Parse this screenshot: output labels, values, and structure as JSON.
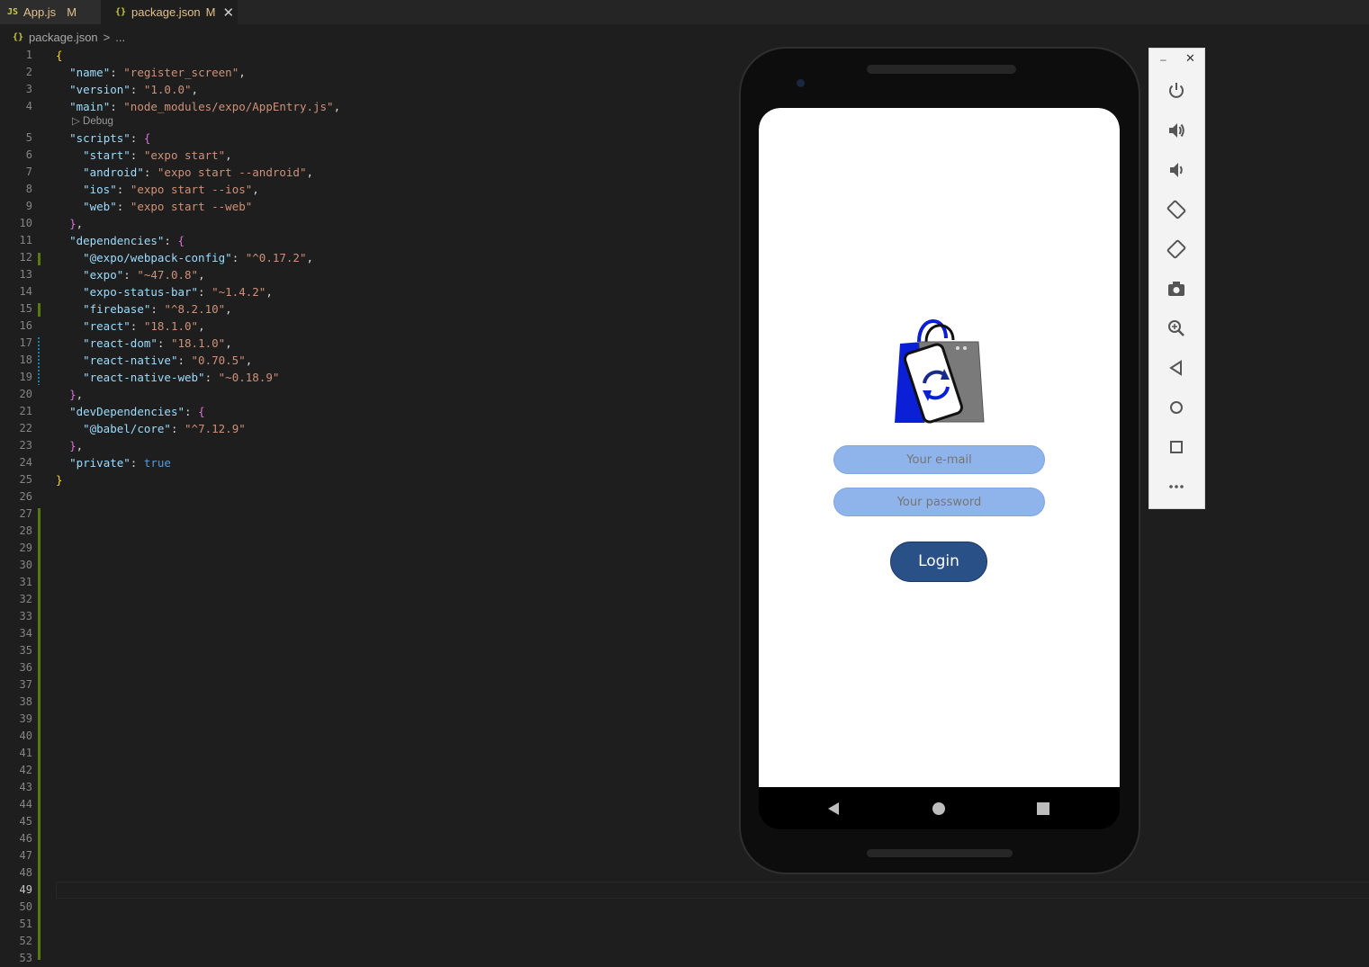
{
  "tabs": [
    {
      "icon": "JS",
      "label": "App.js",
      "status": "M"
    },
    {
      "icon": "{}",
      "label": "package.json",
      "status": "M",
      "close": "✕"
    }
  ],
  "breadcrumb": {
    "icon": "{}",
    "file": "package.json",
    "separator": ">",
    "rest": "..."
  },
  "line_numbers": [
    "1",
    "2",
    "3",
    "4",
    "5",
    "6",
    "7",
    "8",
    "9",
    "10",
    "11",
    "12",
    "13",
    "14",
    "15",
    "16",
    "17",
    "18",
    "19",
    "20",
    "21",
    "22",
    "23",
    "24",
    "25",
    "26",
    "27",
    "28",
    "29",
    "30",
    "31",
    "32",
    "33",
    "34",
    "35",
    "36",
    "37",
    "38",
    "39",
    "40",
    "41",
    "42",
    "43",
    "44",
    "45",
    "46",
    "47",
    "48",
    "49",
    "50",
    "51",
    "52",
    "53"
  ],
  "active_line": "49",
  "code_lens": "▷ Debug",
  "code": {
    "l1": "{",
    "name_k": "\"name\"",
    "name_v": "\"register_screen\"",
    "version_k": "\"version\"",
    "version_v": "\"1.0.0\"",
    "main_k": "\"main\"",
    "main_v": "\"node_modules/expo/AppEntry.js\"",
    "scripts_k": "\"scripts\"",
    "start_k": "\"start\"",
    "start_v": "\"expo start\"",
    "android_k": "\"android\"",
    "android_v": "\"expo start --android\"",
    "ios_k": "\"ios\"",
    "ios_v": "\"expo start --ios\"",
    "web_k": "\"web\"",
    "web_v": "\"expo start --web\"",
    "deps_k": "\"dependencies\"",
    "d1_k": "\"@expo/webpack-config\"",
    "d1_v": "\"^0.17.2\"",
    "d2_k": "\"expo\"",
    "d2_v": "\"~47.0.8\"",
    "d3_k": "\"expo-status-bar\"",
    "d3_v": "\"~1.4.2\"",
    "d4_k": "\"firebase\"",
    "d4_v": "\"^8.2.10\"",
    "d5_k": "\"react\"",
    "d5_v": "\"18.1.0\"",
    "d6_k": "\"react-dom\"",
    "d6_v": "\"18.1.0\"",
    "d7_k": "\"react-native\"",
    "d7_v": "\"0.70.5\"",
    "d8_k": "\"react-native-web\"",
    "d8_v": "\"~0.18.9\"",
    "devdeps_k": "\"devDependencies\"",
    "dd1_k": "\"@babel/core\"",
    "dd1_v": "\"^7.12.9\"",
    "private_k": "\"private\"",
    "private_v": "true",
    "l25": "}"
  },
  "phone": {
    "email_placeholder": "Your e-mail",
    "password_placeholder": "Your password",
    "login_label": "Login"
  },
  "emulator_toolbar": {
    "minimize": "–",
    "close": "✕",
    "buttons": [
      "power-icon",
      "volume-up-icon",
      "volume-down-icon",
      "rotate-left-icon",
      "rotate-right-icon",
      "camera-icon",
      "zoom-icon",
      "back-icon",
      "home-icon",
      "overview-icon",
      "more-icon"
    ]
  },
  "colors": {
    "editor_bg": "#1e1e1e",
    "json_key": "#9cdcfe",
    "json_string": "#ce9178",
    "login_button": "#2a5088",
    "input_fill": "#8fb4ec",
    "logo_blue": "#0a1fd6"
  }
}
